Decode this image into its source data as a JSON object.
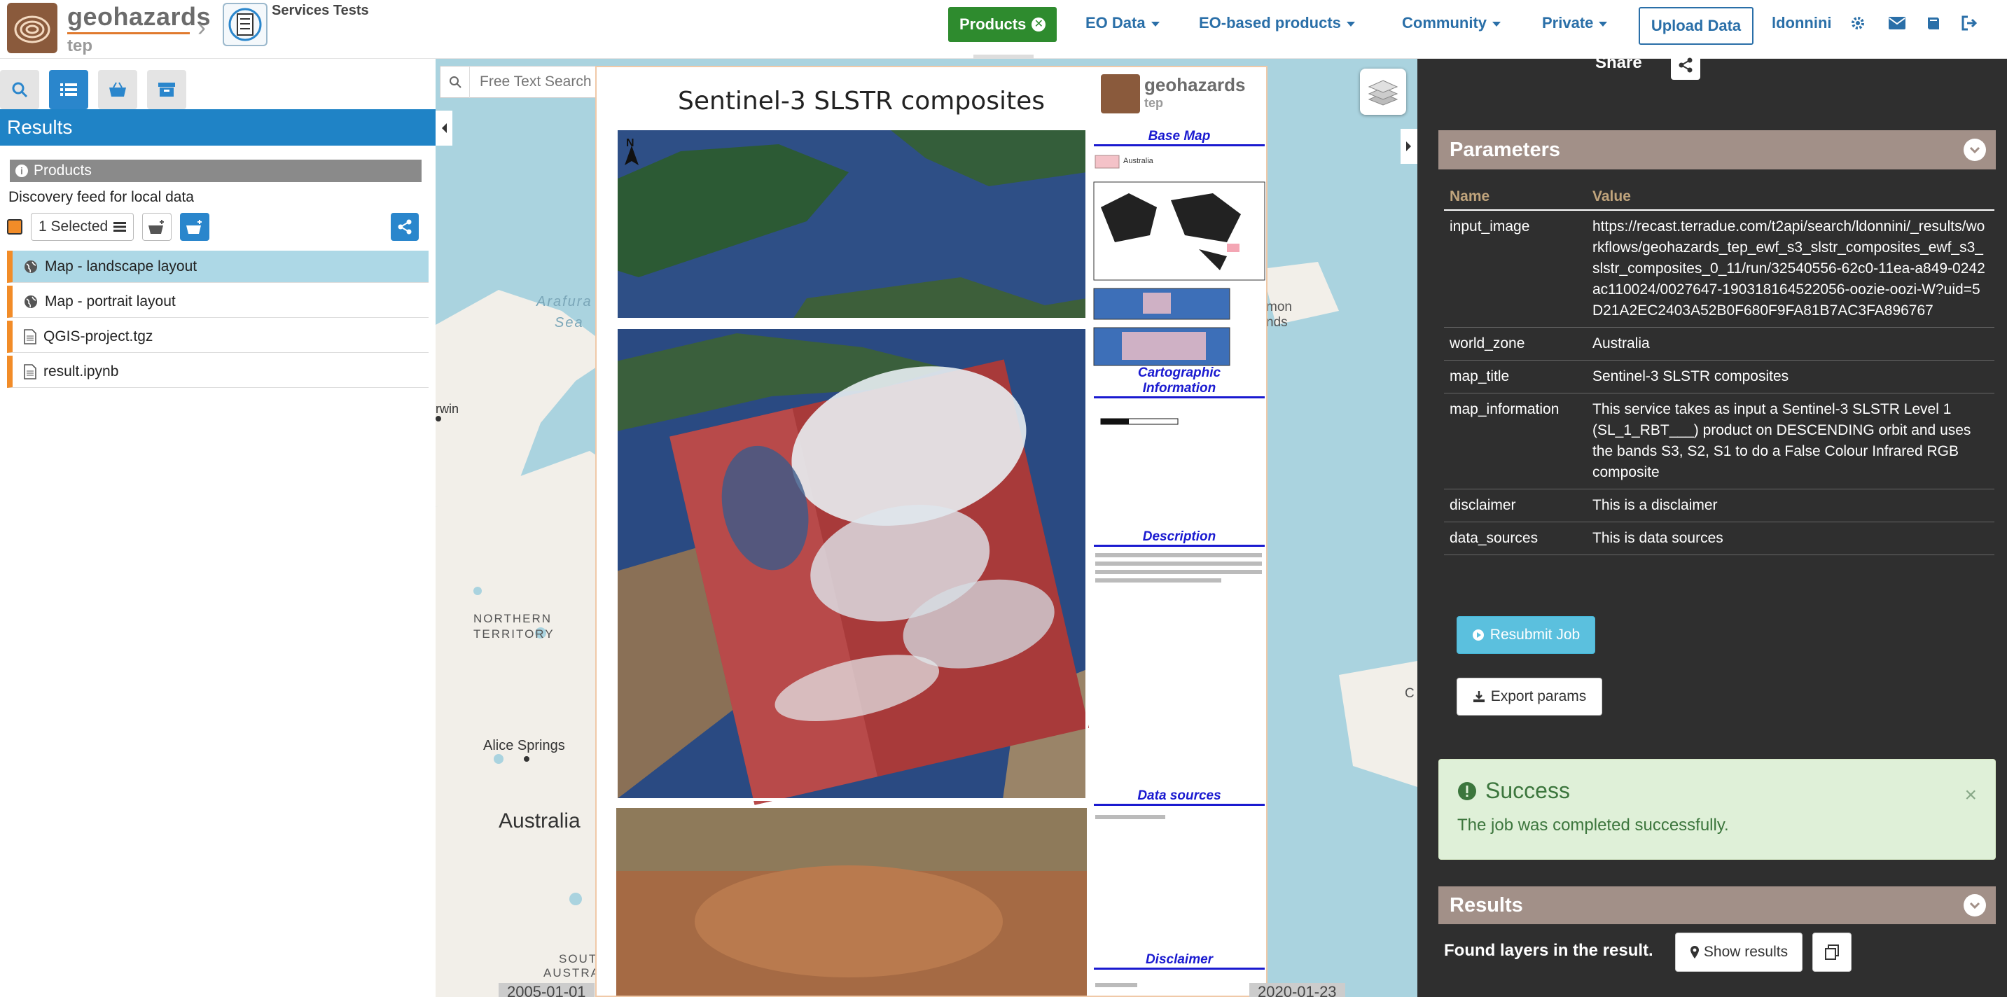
{
  "header": {
    "brand_name": "geohazards",
    "brand_sub": "tep",
    "service_title": "Services Tests",
    "nav": {
      "products": "Products",
      "eo_data": "EO Data",
      "eo_based_products": "EO-based products",
      "community": "Community",
      "private": "Private",
      "upload_data": "Upload Data",
      "user": "ldonnini"
    },
    "icons": [
      "gear-icon",
      "envelope-icon",
      "book-icon",
      "sign-out-icon"
    ],
    "colors": {
      "products_active": "#2e8b2e",
      "link": "#2a6fa8",
      "brand_underline": "#e07a2e"
    }
  },
  "left_panel": {
    "results_title": "Results",
    "products_label": "Products",
    "feed_label": "Discovery feed for local data",
    "selected_label": "1 Selected",
    "items": [
      {
        "label": "Map - landscape layout",
        "icon": "globe-icon",
        "active": true
      },
      {
        "label": "Map - portrait layout",
        "icon": "globe-icon",
        "active": false
      },
      {
        "label": "QGIS-project.tgz",
        "icon": "file-icon",
        "active": false
      },
      {
        "label": "result.ipynb",
        "icon": "file-icon",
        "active": false
      }
    ],
    "colors": {
      "results_bar": "#1f83c6",
      "item_marker": "#f28c28",
      "active_item": "#add8e6"
    }
  },
  "map": {
    "search_placeholder": "Free Text Search",
    "labels": {
      "arafura": "Arafura",
      "sea": "Sea",
      "darwin_partial": "rwin",
      "northern": "NORTHERN",
      "territory": "TERRITORY",
      "alice_springs": "Alice Springs",
      "australia": "Australia",
      "south_austr_1": "SOUT",
      "south_austr_2": "AUSTRA",
      "solomon_partial_1": "mon",
      "solomon_partial_2": "nds",
      "right_edge": "C"
    },
    "date_start": "2005-01-01",
    "date_end": "2020-01-23",
    "preview": {
      "title": "Sentinel-3 SLSTR composites",
      "logo_name": "geohazards",
      "logo_sub": "tep",
      "north": "N",
      "side_headings": {
        "base_map": "Base Map",
        "legend_item": "Australia",
        "cartographic_1": "Cartographic",
        "cartographic_2": "Information",
        "description": "Description",
        "data_sources": "Data sources",
        "disclaimer": "Disclaimer"
      }
    }
  },
  "right_panel": {
    "share_label": "Share",
    "parameters_title": "Parameters",
    "col_name": "Name",
    "col_value": "Value",
    "params": [
      {
        "name": "input_image",
        "value": "https://recast.terradue.com/t2api/search/ldonnini/_results/workflows/geohazards_tep_ewf_s3_slstr_composites_ewf_s3_slstr_composites_0_11/run/32540556-62c0-11ea-a849-0242ac110024/0027647-190318164522056-oozie-oozi-W?uid=5D21A2EC2403A52B0F680F9FA81B7AC3FA896767"
      },
      {
        "name": "world_zone",
        "value": "Australia"
      },
      {
        "name": "map_title",
        "value": "Sentinel-3 SLSTR composites"
      },
      {
        "name": "map_information",
        "value": "This service takes as input a Sentinel-3 SLSTR Level 1 (SL_1_RBT___) product on DESCENDING orbit and uses the bands S3, S2, S1 to do a False Colour Infrared RGB composite"
      },
      {
        "name": "disclaimer",
        "value": "This is a disclaimer"
      },
      {
        "name": "data_sources",
        "value": "This is data sources"
      }
    ],
    "resubmit_label": "Resubmit Job",
    "export_label": "Export params",
    "alert_title": "Success",
    "alert_message": "The job was completed successfully.",
    "alert_close": "×",
    "results_title": "Results",
    "found_label": "Found layers in the result.",
    "show_results_label": "Show results",
    "colors": {
      "panel_bg": "#2f2f2f",
      "panel_head": "#a29088",
      "header_col": "#c0a47c",
      "success_bg": "#dff0d8",
      "success_text": "#3c763d",
      "resubmit": "#5bc0de"
    }
  }
}
